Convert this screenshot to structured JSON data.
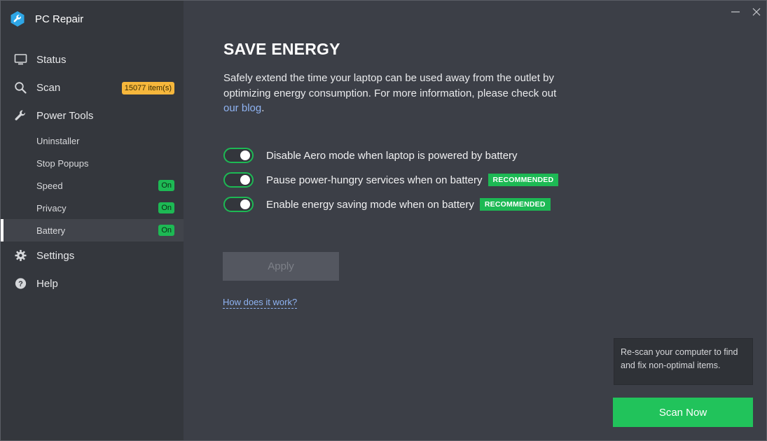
{
  "app": {
    "title": "PC Repair",
    "logo_icon": "wrench-repair-logo-icon"
  },
  "window_controls": {
    "minimize_icon": "minimize-icon",
    "close_icon": "close-icon"
  },
  "sidebar": {
    "items": [
      {
        "label": "Status",
        "icon": "monitor-icon"
      },
      {
        "label": "Scan",
        "icon": "search-icon",
        "badge": "15077 item(s)"
      },
      {
        "label": "Power Tools",
        "icon": "wrench-icon"
      }
    ],
    "sub_items": [
      {
        "label": "Uninstaller"
      },
      {
        "label": "Stop Popups"
      },
      {
        "label": "Speed",
        "badge": "On"
      },
      {
        "label": "Privacy",
        "badge": "On"
      },
      {
        "label": "Battery",
        "badge": "On",
        "active": true
      }
    ],
    "bottom_items": [
      {
        "label": "Settings",
        "icon": "gear-icon"
      },
      {
        "label": "Help",
        "icon": "help-icon"
      }
    ]
  },
  "main": {
    "title": "SAVE ENERGY",
    "description_before_link": "Safely extend the time your laptop can be used away from the outlet by optimizing energy consumption. For more information, please check out ",
    "description_link": "our blog",
    "description_after_link": ".",
    "options": [
      {
        "label": "Disable Aero mode when laptop is powered by battery",
        "enabled": true,
        "tag": ""
      },
      {
        "label": "Pause power-hungry services when on battery",
        "enabled": true,
        "tag": "RECOMMENDED"
      },
      {
        "label": "Enable energy saving mode when on battery",
        "enabled": true,
        "tag": "RECOMMENDED"
      }
    ],
    "apply_label": "Apply",
    "how_link": "How does it work?"
  },
  "scan_panel": {
    "hint": "Re-scan your computer to find and fix non-optimal items.",
    "button_label": "Scan Now"
  },
  "colors": {
    "sidebar_bg": "#34373d",
    "main_bg": "#3c3f47",
    "accent_green": "#1db954",
    "badge_orange": "#f6b73c",
    "link_blue": "#8fb3f2"
  }
}
